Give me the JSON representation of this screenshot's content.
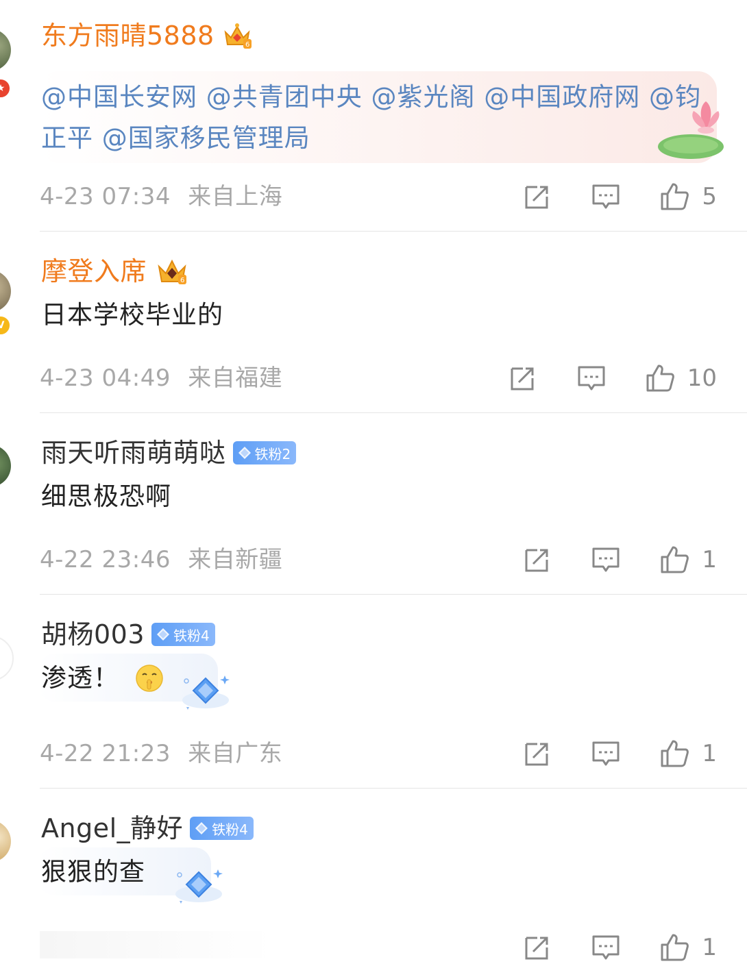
{
  "comments": [
    {
      "username": "东方雨晴5888",
      "mentions": "@中国长安网 @共青团中央 @紫光阁 @中国政府网 @钧正平 @国家移民管理局",
      "time": "4-23 07:34",
      "location": "来自上海",
      "likes": "5"
    },
    {
      "username": "摩登入席",
      "text": "日本学校毕业的",
      "time": "4-23 04:49",
      "location": "来自福建",
      "likes": "10"
    },
    {
      "username": "雨天听雨萌萌哒",
      "fan_badge": "铁粉2",
      "text": "细思极恐啊",
      "time": "4-22 23:46",
      "location": "来自新疆",
      "likes": "1"
    },
    {
      "username": "胡杨003",
      "fan_badge": "铁粉4",
      "text": "渗透！",
      "emoji": "shushing-face-icon",
      "time": "4-22 21:23",
      "location": "来自广东",
      "likes": "1"
    },
    {
      "username": "Angel_静好",
      "fan_badge": "铁粉4",
      "text": "狠狠的查",
      "likes": "1"
    }
  ],
  "colors": {
    "vip_name": "#f07b1d",
    "mention": "#5a86c0",
    "meta": "#a8a8a8",
    "fan_badge": "#5e9ef5"
  }
}
